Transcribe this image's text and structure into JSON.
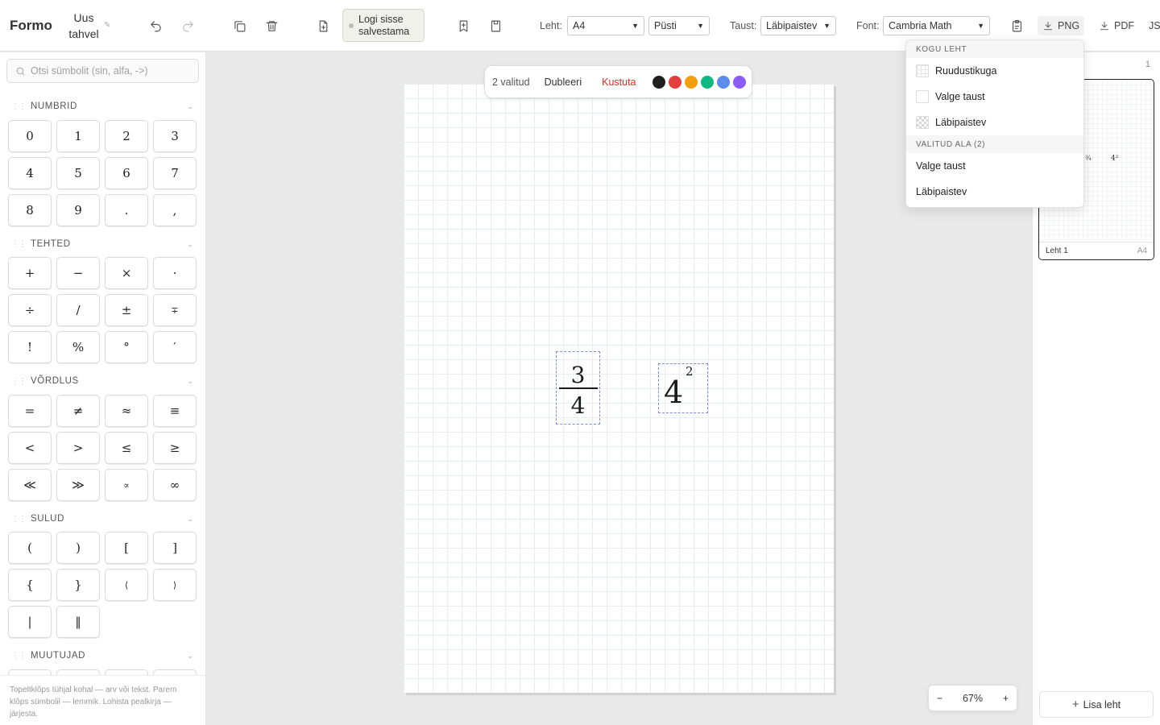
{
  "app": {
    "name": "Formo",
    "doc_title": "Uus tahvel"
  },
  "toolbar": {
    "save_label": "Logi sisse salvestama",
    "page_label": "Leht:",
    "page_size": "A4",
    "orientation": "Püsti",
    "background_label": "Taust:",
    "background_value": "Läbipaistev",
    "font_label": "Font:",
    "font_value": "Cambria Math",
    "export_png": "PNG",
    "export_pdf": "PDF",
    "export_js": "JS"
  },
  "search": {
    "placeholder": "Otsi sümbolit (sin, alfa, ->)"
  },
  "sections": [
    {
      "title": "NUMBRID",
      "symbols": [
        "0",
        "1",
        "2",
        "3",
        "4",
        "5",
        "6",
        "7",
        "8",
        "9",
        ".",
        ","
      ]
    },
    {
      "title": "TEHTED",
      "symbols": [
        "+",
        "−",
        "×",
        "·",
        "÷",
        "/",
        "±",
        "∓",
        "!",
        "%",
        "°",
        "′"
      ]
    },
    {
      "title": "VÕRDLUS",
      "symbols": [
        "=",
        "≠",
        "≈",
        "≡",
        "<",
        ">",
        "≤",
        "≥",
        "≪",
        "≫",
        "∝",
        "∞"
      ]
    },
    {
      "title": "SULUD",
      "symbols": [
        "(",
        ")",
        "[",
        "]",
        "{",
        "}",
        "⟨",
        "⟩",
        "|",
        "‖"
      ]
    },
    {
      "title": "MUUTUJAD",
      "symbols": []
    }
  ],
  "hint": "Topeltklõps tühjal kohal — arv või tekst. Parem klõps sümbolil — lemmik. Lohista pealkirja — järjesta.",
  "selection": {
    "count_label": "2 valitud",
    "duplicate_label": "Dubleeri",
    "delete_label": "Kustuta",
    "colors": [
      "#1f1f1f",
      "#e53e3e",
      "#f59e0b",
      "#10b981",
      "#5b8def",
      "#8b5cf6"
    ]
  },
  "equations": {
    "fraction": {
      "numerator": "3",
      "denominator": "4"
    },
    "power": {
      "base": "4",
      "exponent": "2"
    }
  },
  "zoom": {
    "minus": "−",
    "value": "67%",
    "plus": "+"
  },
  "pages": {
    "count": "1",
    "thumb_fraction": "¾",
    "thumb_power": "4²",
    "items": [
      {
        "label": "Leht 1",
        "format": "A4"
      }
    ],
    "add_label": "Lisa leht"
  },
  "bg_menu": {
    "section_page": "KOGU LEHT",
    "page_options": [
      "Ruudustikuga",
      "Valge taust",
      "Läbipaistev"
    ],
    "section_selection": "VALITUD ALA (2)",
    "selection_options": [
      "Valge taust",
      "Läbipaistev"
    ]
  }
}
